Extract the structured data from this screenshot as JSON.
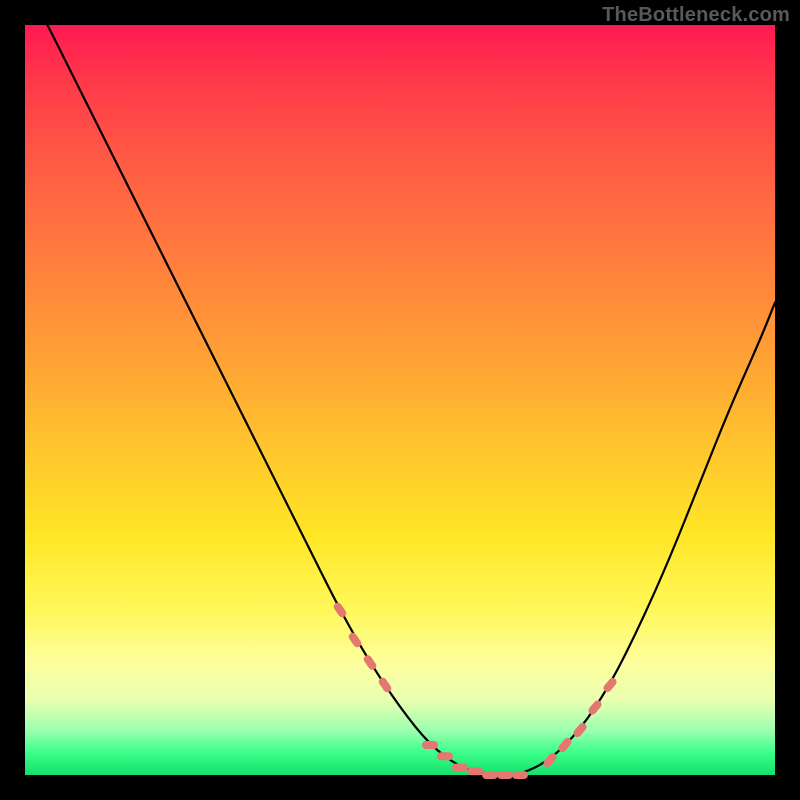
{
  "watermark": "TheBottleneck.com",
  "colors": {
    "background": "#000000",
    "curve": "#000000",
    "marker": "#e4776f",
    "gradient_stops": [
      "#ff1a52",
      "#ff7a3e",
      "#ffe626",
      "#fdff9c",
      "#14e06a"
    ]
  },
  "chart_data": {
    "type": "line",
    "title": "",
    "xlabel": "",
    "ylabel": "",
    "xlim": [
      0,
      100
    ],
    "ylim": [
      0,
      100
    ],
    "grid": false,
    "legend": false,
    "series": [
      {
        "name": "bottleneck-curve",
        "x": [
          3,
          6,
          10,
          14,
          18,
          22,
          26,
          30,
          34,
          38,
          42,
          46,
          50,
          54,
          58,
          62,
          66,
          70,
          74,
          78,
          82,
          86,
          90,
          94,
          98,
          100
        ],
        "y": [
          100,
          94,
          86,
          78,
          70,
          62,
          54,
          46,
          38,
          30,
          22,
          15,
          9,
          4,
          1,
          0,
          0,
          2,
          6,
          12,
          20,
          29,
          39,
          49,
          58,
          63
        ]
      }
    ],
    "markers": {
      "name": "highlighted-points",
      "color": "#e4776f",
      "x": [
        42,
        44,
        46,
        48,
        54,
        56,
        58,
        60,
        62,
        64,
        66,
        70,
        72,
        74,
        76,
        78
      ],
      "y": [
        22,
        18,
        15,
        12,
        4,
        2.5,
        1,
        0.5,
        0,
        0,
        0,
        2,
        4,
        6,
        9,
        12
      ]
    }
  }
}
